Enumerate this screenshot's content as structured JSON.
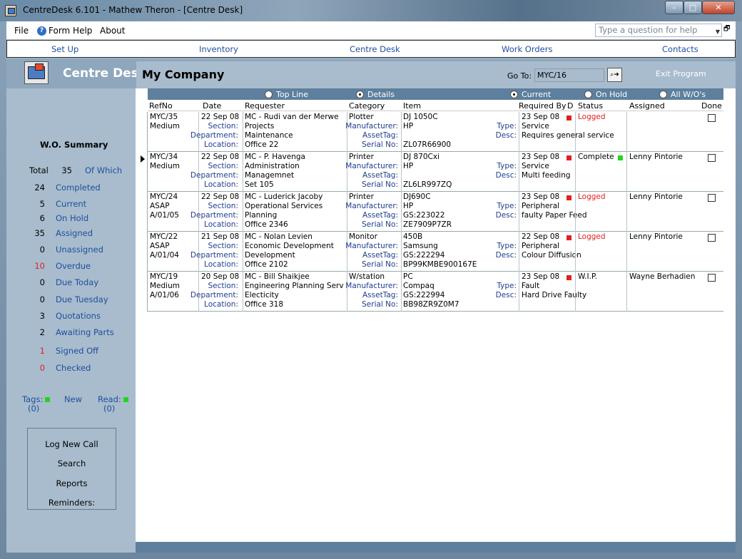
{
  "window": {
    "title": "CentreDesk 6.101 - Mathew Theron - [Centre Desk]",
    "min": "–",
    "max": "□",
    "close": "✕"
  },
  "menu": {
    "file": "File",
    "form_help": "Form Help",
    "about": "About",
    "question_placeholder": "Type a question for help",
    "restore": "🗗"
  },
  "nav": {
    "setup": "Set Up",
    "inventory": "Inventory",
    "centre_desk": "Centre Desk",
    "work_orders": "Work Orders",
    "contacts": "Contacts"
  },
  "header": {
    "title": "Centre Desk:",
    "company": "My Company",
    "goto_label": "Go To:",
    "goto_value": "MYC/16",
    "exit": "Exit Program"
  },
  "summary": {
    "title": "W.O. Summary",
    "total_label": "Total",
    "total_value": "35",
    "of_which": "Of Which",
    "items": [
      {
        "n": "24",
        "label": "Completed"
      },
      {
        "n": "5",
        "label": "Current"
      },
      {
        "n": "6",
        "label": "On Hold"
      },
      {
        "n": "35",
        "label": "Assigned"
      },
      {
        "n": "0",
        "label": "Unassigned"
      },
      {
        "n": "10",
        "label": "Overdue"
      },
      {
        "n": "0",
        "label": "Due Today"
      },
      {
        "n": "0",
        "label": "Due Tuesday"
      },
      {
        "n": "3",
        "label": "Quotations"
      },
      {
        "n": "2",
        "label": "Awaiting Parts"
      },
      {
        "n": "1",
        "label": "Signed Off"
      },
      {
        "n": "0",
        "label": "Checked"
      }
    ],
    "tags_label": "Tags:",
    "tags_count": "(0)",
    "new_label": "New",
    "read_label": "Read:",
    "read_count": "(0)"
  },
  "actions": {
    "log_new_call": "Log New Call",
    "search": "Search",
    "reports": "Reports",
    "reminders": "Reminders:"
  },
  "filters": {
    "top_line": "Top Line",
    "details": "Details",
    "current": "Current",
    "on_hold": "On Hold",
    "all": "All W/O's"
  },
  "columns": {
    "refno": "RefNo",
    "date": "Date",
    "requester": "Requester",
    "category": "Category",
    "item": "Item",
    "required_by": "Required By",
    "d": "D",
    "status": "Status",
    "assigned": "Assigned",
    "done": "Done"
  },
  "labels": {
    "section": "Section:",
    "department": "Department:",
    "location": "Location:",
    "manufacturer": "Manufacturer:",
    "assettag": "AssetTag:",
    "serial": "Serial No:",
    "type": "Type:",
    "desc": "Desc:"
  },
  "colors": {
    "logged": "#e02020",
    "complete": "#22d61a",
    "link": "#1f4e9c"
  },
  "rows": [
    {
      "ref": "MYC/35",
      "priority": "Medium",
      "code": "",
      "date": "22 Sep 08",
      "requester": "MC - Rudi van der Merwe",
      "section": "Projects",
      "department": "Maintenance",
      "location": "Office 22",
      "category": "Plotter",
      "manufacturer": "HP",
      "assettag": "",
      "item": "DJ 1050C",
      "serial": "ZL07R66900",
      "required": "23 Sep 08",
      "type": "Service",
      "desc": "Requires general service",
      "status": "Logged",
      "assigned": ""
    },
    {
      "ref": "MYC/34",
      "priority": "Medium",
      "code": "",
      "date": "22 Sep 08",
      "requester": "MC - P. Havenga",
      "section": "Administration",
      "department": "Managemnet",
      "location": "Set 105",
      "category": "Printer",
      "manufacturer": "HP",
      "assettag": "",
      "item": "DJ 870Cxi",
      "serial": "ZL6LR997ZQ",
      "required": "23 Sep 08",
      "type": "Service",
      "desc": "Multi feeding",
      "status": "Complete",
      "assigned": "Lenny Pintorie"
    },
    {
      "ref": "MYC/24",
      "priority": "ASAP",
      "code": "A/01/05",
      "date": "22 Sep 08",
      "requester": "MC - Luderick Jacoby",
      "section": "Operational Services",
      "department": "Planning",
      "location": "Office 2346",
      "category": "Printer",
      "manufacturer": "HP",
      "assettag": "GS:223022",
      "item": "DJ690C",
      "serial": "ZE7909P7ZR",
      "required": "23 Sep 08",
      "type": "Peripheral",
      "desc": "faulty Paper Feed",
      "status": "Logged",
      "assigned": "Lenny Pintorie"
    },
    {
      "ref": "MYC/22",
      "priority": "ASAP",
      "code": "A/01/04",
      "date": "21 Sep 08",
      "requester": "MC - Nolan Levien",
      "section": "Economic Development",
      "department": "Development",
      "location": "Office 2102",
      "category": "Monitor",
      "manufacturer": "Samsung",
      "assettag": "GS:222294",
      "item": "450B",
      "serial": "BP99KMBE900167E",
      "required": "22 Sep 08",
      "type": "Peripheral",
      "desc": "Colour Diffusion",
      "status": "Logged",
      "assigned": "Lenny Pintorie"
    },
    {
      "ref": "MYC/19",
      "priority": "Medium",
      "code": "A/01/06",
      "date": "20 Sep 08",
      "requester": "MC - Bill Shaikjee",
      "section": "Engineering Planning Serv",
      "department": "Electicity",
      "location": "Office 318",
      "category": "W/station",
      "manufacturer": "Compaq",
      "assettag": "GS:222994",
      "item": "PC",
      "serial": "BB98ZR9Z0M7",
      "required": "23 Sep 08",
      "type": "Fault",
      "desc": "Hard Drive Faulty",
      "status": "W.I.P.",
      "assigned": "Wayne Berhadien"
    }
  ]
}
